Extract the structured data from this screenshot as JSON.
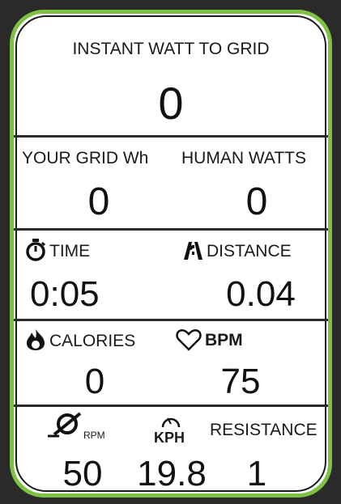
{
  "instant": {
    "label": "INSTANT WATT TO GRID",
    "value": "0"
  },
  "grid_wh": {
    "label": "YOUR GRID Wh",
    "value": "0"
  },
  "human_watts": {
    "label": "HUMAN WATTS",
    "value": "0"
  },
  "time": {
    "label": "TIME",
    "value": "0:05",
    "icon": "stopwatch-icon"
  },
  "distance": {
    "label": "DISTANCE",
    "value": "0.04",
    "icon": "road-icon"
  },
  "calories": {
    "label": "CALORIES",
    "value": "0",
    "icon": "flame-icon"
  },
  "bpm": {
    "label": "BPM",
    "value": "75",
    "icon": "heart-icon"
  },
  "rpm": {
    "label": "RPM",
    "value": "50",
    "icon": "cadence-icon"
  },
  "kph": {
    "label": "KPH",
    "value": "19.8",
    "icon": "speedometer-icon"
  },
  "resistance": {
    "label": "RESISTANCE",
    "value": "1"
  },
  "colors": {
    "frame": "#7dc242",
    "background": "#ffffff",
    "divider": "#2b2b2b"
  }
}
